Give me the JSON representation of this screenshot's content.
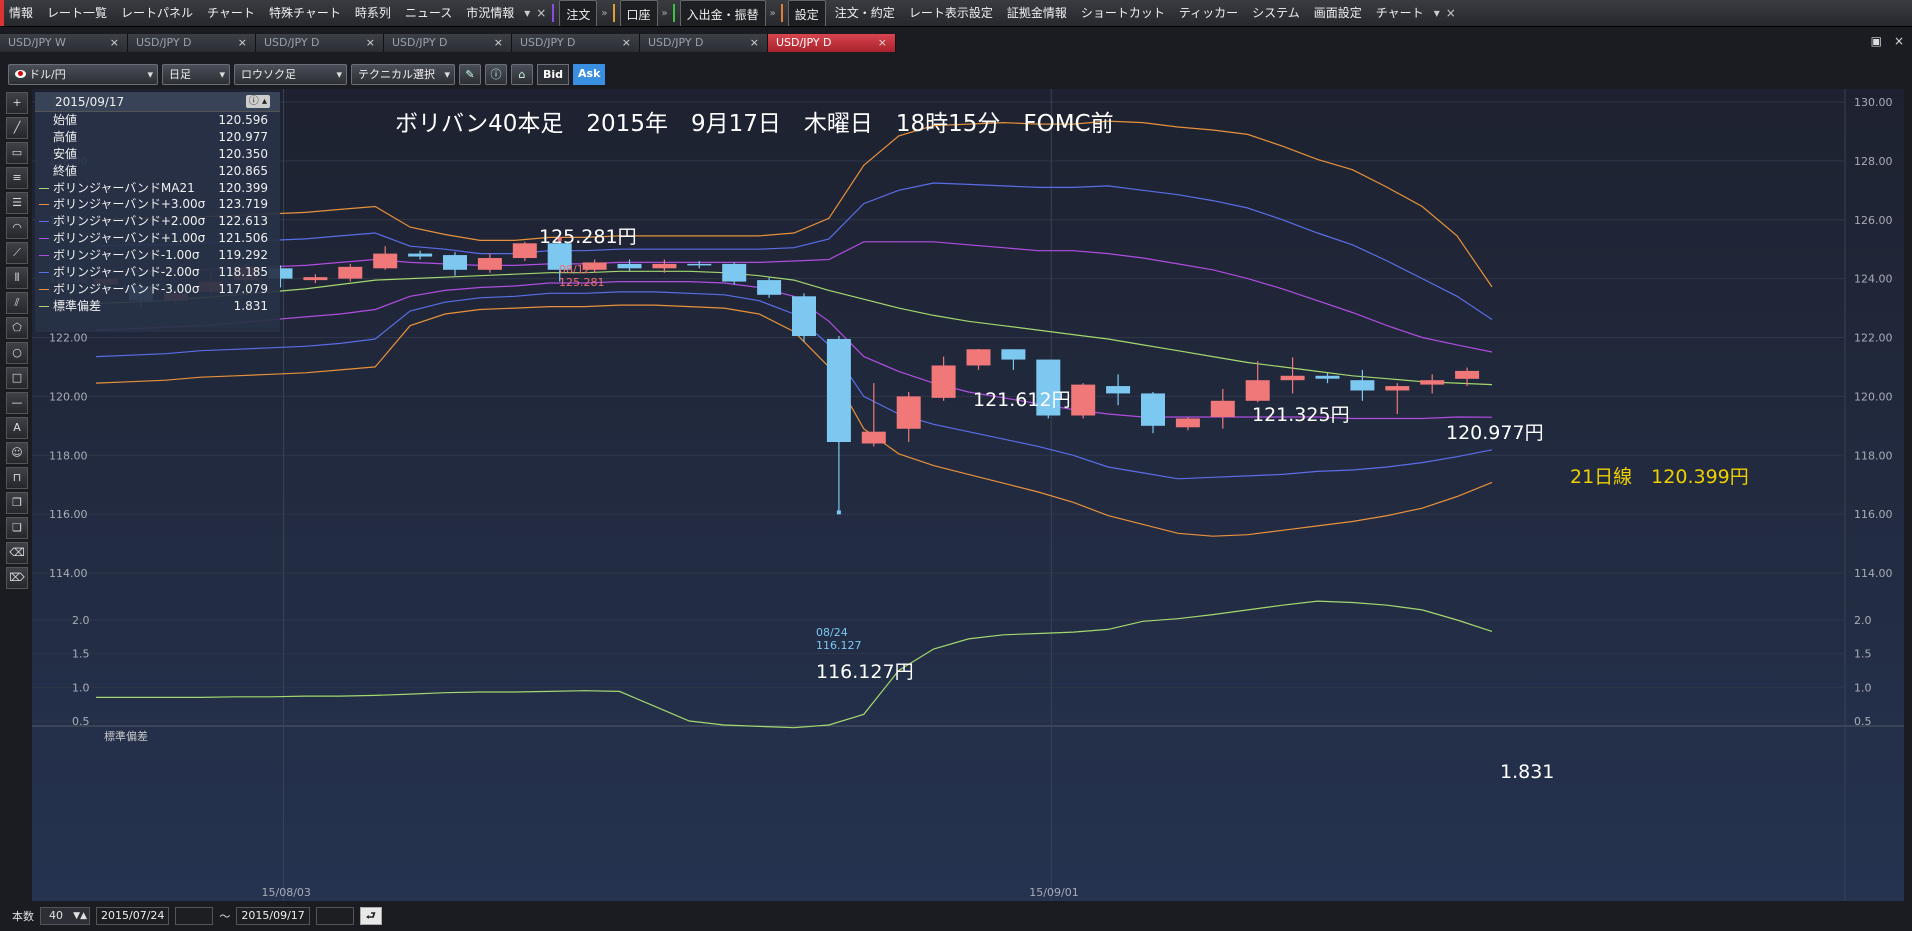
{
  "menu": {
    "items": [
      "情報",
      "レート一覧",
      "レートパネル",
      "チャート",
      "特殊チャート",
      "時系列",
      "ニュース",
      "市況情報"
    ],
    "order_btn": "注文",
    "account_btn": "口座",
    "transfer_btn": "入出金・振替",
    "settings_btn": "設定",
    "right_items": [
      "注文・約定",
      "レート表示設定",
      "証拠金情報",
      "ショートカット",
      "ティッカー",
      "システム",
      "画面設定",
      "チャート"
    ],
    "close": "×"
  },
  "tabs": [
    {
      "label": "USD/JPY W",
      "active": false
    },
    {
      "label": "USD/JPY D",
      "active": false
    },
    {
      "label": "USD/JPY D",
      "active": false
    },
    {
      "label": "USD/JPY D",
      "active": false
    },
    {
      "label": "USD/JPY D",
      "active": false
    },
    {
      "label": "USD/JPY D",
      "active": false
    },
    {
      "label": "USD/JPY D",
      "active": true
    }
  ],
  "tab_close": "×",
  "toolbar": {
    "symbol": "ドル/円",
    "period": "日足",
    "chart_type": "ロウソク足",
    "technical": "テクニカル選択",
    "bid": "Bid",
    "ask": "Ask"
  },
  "info_panel": {
    "date": "2015/09/17",
    "rows": [
      {
        "label": "始値",
        "value": "120.596",
        "color": ""
      },
      {
        "label": "高値",
        "value": "120.977",
        "color": ""
      },
      {
        "label": "安値",
        "value": "120.350",
        "color": ""
      },
      {
        "label": "終値",
        "value": "120.865",
        "color": ""
      },
      {
        "label": "ボリンジャーバンドMA21",
        "value": "120.399",
        "color": "#a4d86e"
      },
      {
        "label": "ボリンジャーバンド+3.00σ",
        "value": "123.719",
        "color": "#e8913a"
      },
      {
        "label": "ボリンジャーバンド+2.00σ",
        "value": "122.613",
        "color": "#5a6de8"
      },
      {
        "label": "ボリンジャーバンド+1.00σ",
        "value": "121.506",
        "color": "#b04de0"
      },
      {
        "label": "ボリンジャーバンド-1.00σ",
        "value": "119.292",
        "color": "#b04de0"
      },
      {
        "label": "ボリンジャーバンド-2.00σ",
        "value": "118.185",
        "color": "#5a6de8"
      },
      {
        "label": "ボリンジャーバンド-3.00σ",
        "value": "117.079",
        "color": "#e8913a"
      },
      {
        "label": "標準偏差",
        "value": "1.831",
        "color": "#a4d86e"
      }
    ]
  },
  "annotations": {
    "title": "ボリバン40本足　2015年　9月17日　木曜日　18時15分　FOMC前",
    "high_label": "125.281円",
    "high_marker_date": "08/12",
    "high_marker_value": "125.281",
    "low_label": "116.127円",
    "low_marker_date": "08/24",
    "low_marker_value": "116.127",
    "mid_high_label": "121.612円",
    "later_high_label": "121.325円",
    "last_high_label": "120.977円",
    "ma_label": "21日線　120.399円",
    "sd_value_label": "1.831",
    "sd_panel_title": "標準偏差"
  },
  "chart_data": {
    "type": "candlestick",
    "x_tick_labels": [
      "15/08/03",
      "15/09/01"
    ],
    "price_axis": {
      "range": [
        114.0,
        130.0
      ],
      "ticks": [
        "114.00",
        "116.00",
        "118.00",
        "120.00",
        "122.00",
        "124.00",
        "126.00",
        "128.00",
        "130.00"
      ]
    },
    "sd_axis": {
      "range": [
        0.5,
        2.0
      ],
      "ticks": [
        "0.5",
        "1.0",
        "1.5",
        "2.0"
      ]
    },
    "candles": [
      {
        "o": 123.8,
        "c": 124.0,
        "h": 124.1,
        "l": 123.7
      },
      {
        "o": 123.75,
        "c": 123.25,
        "h": 123.85,
        "l": 123.05
      },
      {
        "o": 123.25,
        "c": 123.5,
        "h": 123.6,
        "l": 123.15
      },
      {
        "o": 123.55,
        "c": 123.9,
        "h": 124.2,
        "l": 123.45
      },
      {
        "o": 123.95,
        "c": 124.4,
        "h": 124.5,
        "l": 123.85
      },
      {
        "o": 124.35,
        "c": 124.0,
        "h": 124.45,
        "l": 123.7
      },
      {
        "o": 123.95,
        "c": 124.05,
        "h": 124.15,
        "l": 123.85
      },
      {
        "o": 124.0,
        "c": 124.4,
        "h": 124.5,
        "l": 123.9
      },
      {
        "o": 124.35,
        "c": 124.85,
        "h": 125.1,
        "l": 124.3
      },
      {
        "o": 124.85,
        "c": 124.75,
        "h": 124.95,
        "l": 124.65
      },
      {
        "o": 124.8,
        "c": 124.3,
        "h": 124.9,
        "l": 124.1
      },
      {
        "o": 124.3,
        "c": 124.7,
        "h": 124.85,
        "l": 124.2
      },
      {
        "o": 124.7,
        "c": 125.2,
        "h": 125.25,
        "l": 124.6
      },
      {
        "o": 125.2,
        "c": 124.3,
        "h": 125.281,
        "l": 123.9
      },
      {
        "o": 124.3,
        "c": 124.55,
        "h": 124.65,
        "l": 124.2
      },
      {
        "o": 124.5,
        "c": 124.35,
        "h": 124.65,
        "l": 124.25
      },
      {
        "o": 124.35,
        "c": 124.5,
        "h": 124.65,
        "l": 124.2
      },
      {
        "o": 124.5,
        "c": 124.45,
        "h": 124.6,
        "l": 124.35
      },
      {
        "o": 124.5,
        "c": 123.9,
        "h": 124.55,
        "l": 123.8
      },
      {
        "o": 123.95,
        "c": 123.45,
        "h": 124.05,
        "l": 123.35
      },
      {
        "o": 123.4,
        "c": 122.05,
        "h": 123.5,
        "l": 121.85
      },
      {
        "o": 121.95,
        "c": 118.45,
        "h": 122.05,
        "l": 116.127
      },
      {
        "o": 118.4,
        "c": 118.8,
        "h": 120.45,
        "l": 118.3
      },
      {
        "o": 118.9,
        "c": 120.0,
        "h": 120.15,
        "l": 118.45
      },
      {
        "o": 119.95,
        "c": 121.05,
        "h": 121.35,
        "l": 119.85
      },
      {
        "o": 121.05,
        "c": 121.6,
        "h": 121.612,
        "l": 120.9
      },
      {
        "o": 121.6,
        "c": 121.25,
        "h": 121.6,
        "l": 120.9
      },
      {
        "o": 121.25,
        "c": 119.35,
        "h": 121.25,
        "l": 119.25
      },
      {
        "o": 119.35,
        "c": 120.4,
        "h": 120.45,
        "l": 119.25
      },
      {
        "o": 120.35,
        "c": 120.1,
        "h": 120.75,
        "l": 119.7
      },
      {
        "o": 120.1,
        "c": 119.0,
        "h": 120.15,
        "l": 118.75
      },
      {
        "o": 118.95,
        "c": 119.25,
        "h": 119.3,
        "l": 118.85
      },
      {
        "o": 119.3,
        "c": 119.85,
        "h": 120.25,
        "l": 118.9
      },
      {
        "o": 119.85,
        "c": 120.55,
        "h": 121.2,
        "l": 119.8
      },
      {
        "o": 120.55,
        "c": 120.7,
        "h": 121.325,
        "l": 120.1
      },
      {
        "o": 120.7,
        "c": 120.6,
        "h": 120.8,
        "l": 120.45
      },
      {
        "o": 120.55,
        "c": 120.2,
        "h": 120.9,
        "l": 119.85
      },
      {
        "o": 120.2,
        "c": 120.35,
        "h": 120.45,
        "l": 119.4
      },
      {
        "o": 120.4,
        "c": 120.55,
        "h": 120.75,
        "l": 120.1
      },
      {
        "o": 120.596,
        "c": 120.865,
        "h": 120.977,
        "l": 120.35
      }
    ],
    "bands": {
      "upper3": [
        126.0,
        126.05,
        126.05,
        126.1,
        126.15,
        126.2,
        126.25,
        126.35,
        126.45,
        125.75,
        125.5,
        125.3,
        125.3,
        125.4,
        125.4,
        125.45,
        125.45,
        125.45,
        125.45,
        125.45,
        125.55,
        126.05,
        127.85,
        128.85,
        129.2,
        129.25,
        129.3,
        129.25,
        129.25,
        129.35,
        129.3,
        129.15,
        129.05,
        128.9,
        128.5,
        128.05,
        127.7,
        127.1,
        126.45,
        125.45,
        123.719
      ],
      "upper2": [
        125.1,
        125.15,
        125.15,
        125.2,
        125.25,
        125.3,
        125.35,
        125.45,
        125.55,
        125.1,
        125.0,
        124.85,
        124.85,
        124.95,
        124.95,
        125.0,
        125.0,
        125.0,
        125.0,
        125.0,
        125.05,
        125.35,
        126.55,
        127.0,
        127.25,
        127.2,
        127.15,
        127.1,
        127.1,
        127.15,
        127.0,
        126.85,
        126.65,
        126.4,
        126.0,
        125.55,
        125.15,
        124.6,
        124.0,
        123.4,
        122.613
      ],
      "upper1": [
        124.2,
        124.25,
        124.25,
        124.3,
        124.35,
        124.4,
        124.45,
        124.55,
        124.65,
        124.55,
        124.5,
        124.45,
        124.45,
        124.5,
        124.5,
        124.55,
        124.55,
        124.55,
        124.55,
        124.55,
        124.6,
        124.65,
        125.25,
        125.25,
        125.25,
        125.15,
        125.05,
        124.95,
        124.95,
        124.85,
        124.7,
        124.5,
        124.3,
        124.0,
        123.65,
        123.25,
        122.85,
        122.4,
        122.0,
        121.75,
        121.506
      ],
      "ma": [
        123.15,
        123.2,
        123.25,
        123.35,
        123.45,
        123.55,
        123.65,
        123.8,
        123.95,
        124.0,
        124.05,
        124.1,
        124.15,
        124.2,
        124.2,
        124.25,
        124.25,
        124.25,
        124.2,
        124.1,
        123.95,
        123.6,
        123.3,
        123.0,
        122.75,
        122.55,
        122.4,
        122.25,
        122.1,
        121.95,
        121.75,
        121.55,
        121.35,
        121.15,
        121.0,
        120.85,
        120.7,
        120.6,
        120.5,
        120.45,
        120.399
      ],
      "lower1": [
        122.25,
        122.3,
        122.35,
        122.4,
        122.5,
        122.6,
        122.7,
        122.8,
        122.95,
        123.4,
        123.6,
        123.7,
        123.75,
        123.85,
        123.85,
        123.9,
        123.9,
        123.9,
        123.85,
        123.7,
        123.4,
        122.55,
        121.35,
        120.85,
        120.45,
        120.15,
        119.95,
        119.75,
        119.55,
        119.4,
        119.3,
        119.3,
        119.3,
        119.3,
        119.3,
        119.3,
        119.25,
        119.25,
        119.25,
        119.3,
        119.292
      ],
      "lower2": [
        121.35,
        121.4,
        121.45,
        121.55,
        121.6,
        121.65,
        121.7,
        121.8,
        121.95,
        122.9,
        123.2,
        123.35,
        123.4,
        123.5,
        123.5,
        123.55,
        123.55,
        123.5,
        123.45,
        123.25,
        122.8,
        121.75,
        120.0,
        119.4,
        119.05,
        118.8,
        118.55,
        118.3,
        118.0,
        117.6,
        117.4,
        117.2,
        117.25,
        117.3,
        117.35,
        117.45,
        117.5,
        117.6,
        117.75,
        117.95,
        118.185
      ],
      "lower3": [
        120.45,
        120.5,
        120.55,
        120.65,
        120.7,
        120.75,
        120.8,
        120.9,
        121.0,
        122.4,
        122.8,
        122.95,
        123.0,
        123.05,
        123.05,
        123.1,
        123.1,
        123.05,
        123.0,
        122.8,
        122.2,
        121.0,
        118.9,
        118.05,
        117.65,
        117.35,
        117.05,
        116.75,
        116.4,
        115.95,
        115.65,
        115.35,
        115.25,
        115.3,
        115.45,
        115.6,
        115.75,
        115.95,
        116.2,
        116.6,
        117.079
      ]
    },
    "std_dev": [
      0.85,
      0.85,
      0.85,
      0.85,
      0.86,
      0.86,
      0.87,
      0.87,
      0.88,
      0.9,
      0.92,
      0.93,
      0.93,
      0.94,
      0.95,
      0.94,
      0.72,
      0.5,
      0.44,
      0.42,
      0.4,
      0.44,
      0.6,
      1.25,
      1.57,
      1.72,
      1.78,
      1.8,
      1.82,
      1.86,
      1.98,
      2.02,
      2.08,
      2.15,
      2.22,
      2.28,
      2.26,
      2.22,
      2.15,
      2.0,
      1.831
    ]
  }
}
